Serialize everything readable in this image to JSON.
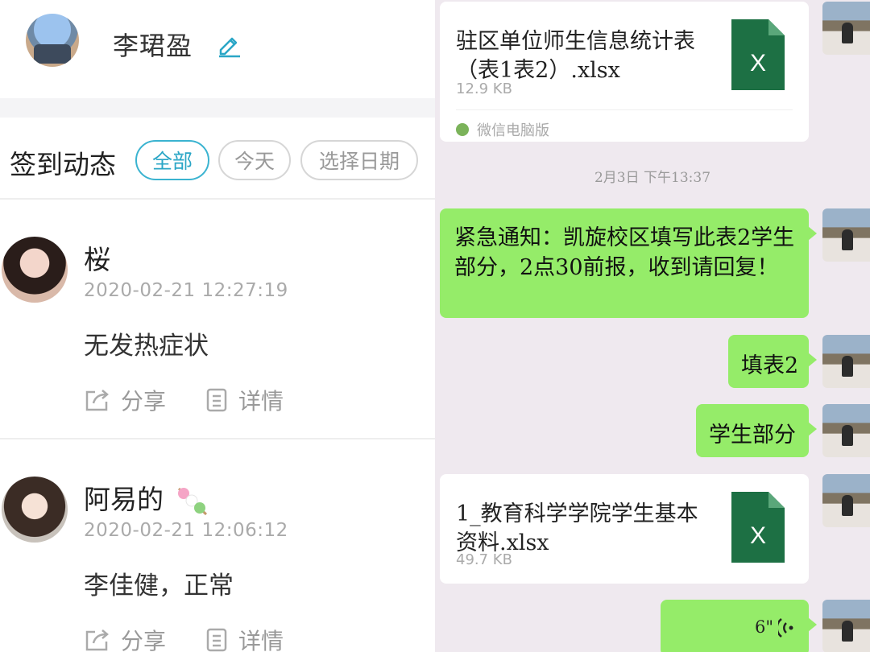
{
  "profile": {
    "name": "李珺盈",
    "edit_icon": "pencil-icon"
  },
  "filter": {
    "title": "签到动态",
    "chips": [
      {
        "label": "全部",
        "active": true
      },
      {
        "label": "今天",
        "active": false
      },
      {
        "label": "选择日期",
        "active": false
      }
    ]
  },
  "posts": [
    {
      "name": "桜",
      "time": "2020-02-21 12:27:19",
      "content": "无发热症状",
      "share_label": "分享",
      "detail_label": "详情"
    },
    {
      "name": "阿易的",
      "name_emoji": "dango-icon",
      "time": "2020-02-21 12:06:12",
      "content": "李佳健，正常",
      "share_label": "分享",
      "detail_label": "详情"
    }
  ],
  "chat": {
    "file_1": {
      "name": "驻区单位师生信息统计表（表1表2）.xlsx",
      "size": "12.9 KB",
      "source": "微信电脑版",
      "icon": "excel-file-icon",
      "icon_letter": "X"
    },
    "timestamp": "2月3日 下午13:37",
    "message_1": "紧急通知：凯旋校区填写此表2学生部分，2点30前报，收到请回复！",
    "message_2": "填表2",
    "message_3": "学生部分",
    "file_2": {
      "name": "1_教育科学学院学生基本资料.xlsx",
      "size": "49.7 KB",
      "icon": "excel-file-icon",
      "icon_letter": "X"
    },
    "voice": {
      "duration": "6\"",
      "icon": "voice-wave-icon"
    }
  },
  "colors": {
    "accent": "#2aa6c6",
    "bubble_green": "#95ec69",
    "excel_green": "#1d7044",
    "chat_bg": "#efe9ef"
  }
}
